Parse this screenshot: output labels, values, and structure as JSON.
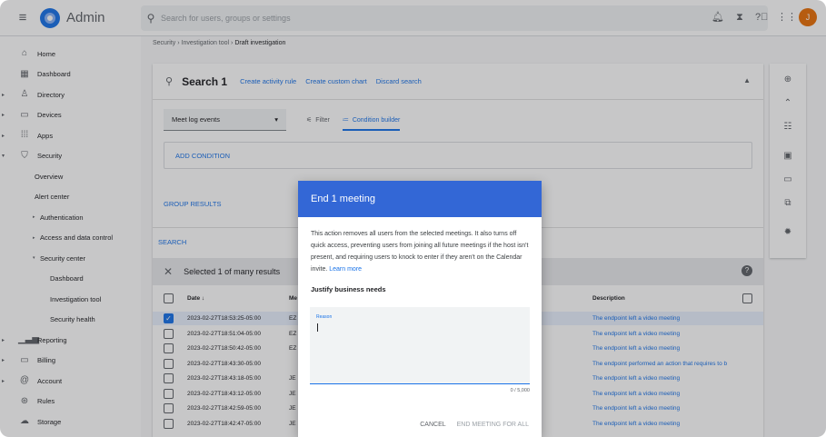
{
  "app": {
    "title": "Admin",
    "avatar_letter": "J"
  },
  "search": {
    "placeholder": "Search for users, groups or settings"
  },
  "topbar": {
    "icons": [
      "bell-icon",
      "hourglass-icon",
      "help-icon",
      "apps-grid-icon"
    ]
  },
  "sidebar": {
    "items": [
      {
        "label": "Home",
        "icon": "home-icon"
      },
      {
        "label": "Dashboard",
        "icon": "dashboard-icon"
      },
      {
        "label": "Directory",
        "icon": "person-icon"
      },
      {
        "label": "Devices",
        "icon": "devices-icon"
      },
      {
        "label": "Apps",
        "icon": "apps-icon"
      },
      {
        "label": "Security",
        "icon": "shield-icon"
      },
      {
        "label": "Overview"
      },
      {
        "label": "Alert center"
      },
      {
        "label": "Authentication"
      },
      {
        "label": "Access and data control"
      },
      {
        "label": "Security center"
      },
      {
        "label": "Dashboard"
      },
      {
        "label": "Investigation tool"
      },
      {
        "label": "Security health"
      },
      {
        "label": "Reporting",
        "icon": "bar-chart-icon"
      },
      {
        "label": "Billing",
        "icon": "credit-card-icon"
      },
      {
        "label": "Account",
        "icon": "at-icon"
      },
      {
        "label": "Rules",
        "icon": "rules-icon"
      },
      {
        "label": "Storage",
        "icon": "cloud-icon"
      }
    ]
  },
  "breadcrumb": {
    "part1": "Security",
    "sep": "›",
    "part2": "Investigation tool",
    "part3": "Draft investigation"
  },
  "card": {
    "title": "Search 1",
    "links": [
      "Create activity rule",
      "Create custom chart",
      "Discard search"
    ],
    "data_source": "Meet log events",
    "filter_tab": "Filter",
    "builder_tab": "Condition builder",
    "add_condition": "ADD CONDITION",
    "group_results": "GROUP RESULTS",
    "search_button": "SEARCH",
    "selection_text": "Selected 1 of many results"
  },
  "table": {
    "headers": {
      "date": "Date ↓",
      "meeting": "Me",
      "description": "Description"
    },
    "rows": [
      {
        "date": "2023-02-27T18:53:25-05:00",
        "meeting": "EZ",
        "description": "The endpoint left a video meeting",
        "selected": true
      },
      {
        "date": "2023-02-27T18:51:04-05:00",
        "meeting": "EZ",
        "description": "The endpoint left a video meeting",
        "selected": false
      },
      {
        "date": "2023-02-27T18:50:42-05:00",
        "meeting": "EZ",
        "description": "The endpoint left a video meeting",
        "selected": false
      },
      {
        "date": "2023-02-27T18:43:30-05:00",
        "meeting": "",
        "description": "The endpoint performed an action that requires to b",
        "selected": false
      },
      {
        "date": "2023-02-27T18:43:18-05:00",
        "meeting": "JE",
        "description": "The endpoint left a video meeting",
        "selected": false
      },
      {
        "date": "2023-02-27T18:43:12-05:00",
        "meeting": "JE",
        "description": "The endpoint left a video meeting",
        "selected": false
      },
      {
        "date": "2023-02-27T18:42:59-05:00",
        "meeting": "JE",
        "description": "The endpoint left a video meeting",
        "selected": false
      },
      {
        "date": "2023-02-27T18:42:47-05:00",
        "meeting": "JE",
        "description": "The endpoint left a video meeting",
        "selected": false
      }
    ]
  },
  "right_toolbar": {
    "icons": [
      "add-circle-icon",
      "collapse-icon",
      "table-settings-icon",
      "save-icon",
      "folder-icon",
      "copy-icon",
      "settings-icon"
    ]
  },
  "modal": {
    "title": "End 1 meeting",
    "body": "This action removes all users from the selected meetings. It also turns off quick access, preventing users from joining all future meetings if the host isn't present, and requiring users to knock to enter if they aren't on the Calendar invite.",
    "learn_more": "Learn more",
    "justify_label": "Justify business needs",
    "reason_label": "Reason",
    "counter": "0 / 5,000",
    "cancel": "CANCEL",
    "confirm": "END MEETING FOR ALL"
  },
  "colors": {
    "primary": "#1a73e8",
    "modal_header": "#3367d6",
    "avatar": "#e8710a"
  }
}
